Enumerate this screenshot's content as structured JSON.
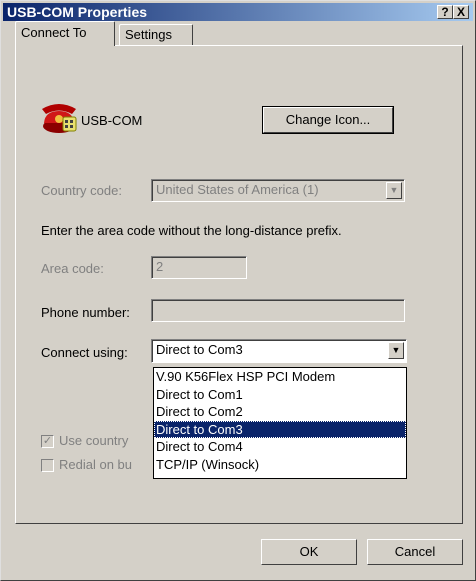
{
  "window": {
    "title": "USB-COM Properties",
    "help_button": "?",
    "close_button": "X"
  },
  "tabs": [
    {
      "label": "Connect To",
      "active": true
    },
    {
      "label": "Settings",
      "active": false
    }
  ],
  "connection": {
    "name": "USB-COM",
    "change_icon_label": "Change Icon..."
  },
  "country": {
    "label": "Country code:",
    "value": "United States of America (1)"
  },
  "instructions": "Enter the area code without the long-distance prefix.",
  "area": {
    "label": "Area code:",
    "value": "2"
  },
  "phone": {
    "label": "Phone number:",
    "value": ""
  },
  "connect_using": {
    "label": "Connect using:",
    "value": "Direct to Com3",
    "options": [
      "V.90 K56Flex HSP PCI Modem",
      "Direct to Com1",
      "Direct to Com2",
      "Direct to Com3",
      "Direct to Com4",
      "TCP/IP (Winsock)"
    ],
    "selected_index": 3
  },
  "checkboxes": {
    "use_country": {
      "label": "Use country",
      "checked": true
    },
    "redial": {
      "label": "Redial on bu",
      "checked": false
    }
  },
  "buttons": {
    "ok": "OK",
    "cancel": "Cancel"
  },
  "colors": {
    "titlebar_start": "#0a246a",
    "titlebar_end": "#a6caf0",
    "selection": "#0a246a",
    "face": "#d4d0c8"
  }
}
